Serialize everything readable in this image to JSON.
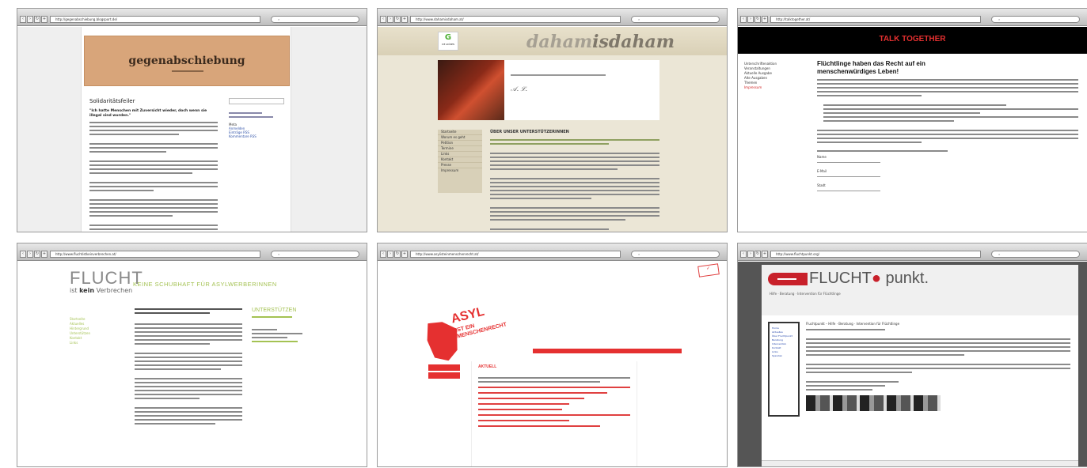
{
  "windows": [
    {
      "url": "http://gegenabschiebung.blogsport.de/",
      "page": {
        "blog_title": "gegenabschiebung",
        "section_title": "Solidaritätsfeiler",
        "quote": "\"Ich hatte Menschen mit Zuversicht wieder, doch wenn sie illegal sind wurden.\"",
        "sidebar_heading": "Meta",
        "sidebar_items": [
          "Anmelden",
          "Einträge RSS",
          "Kommentare RSS"
        ]
      }
    },
    {
      "url": "http://www.dahamisdaham.at/",
      "page": {
        "logo_letter": "G",
        "logo_sub": "DIE GRÜNEN",
        "site_title_prefix": "daham",
        "site_title_suffix": "isdaham",
        "heading": "ÜBER UNSER UNTERSTÜTZERINNEN",
        "menu": [
          "Startseite",
          "Worum es geht",
          "Petition",
          "Termine",
          "Links",
          "Kontakt",
          "Presse",
          "Impressum"
        ]
      }
    },
    {
      "url": "http://talktogether.at/",
      "page": {
        "banner": "TALK TOGETHER",
        "heading": "Flüchtlinge haben das Recht auf ein menschenwürdiges Leben!",
        "nav": [
          "Unterschriftenaktion",
          "Veranstaltungen",
          "Aktuelle Ausgabe",
          "Alte Ausgaben",
          "Themen",
          "Impressum"
        ],
        "fields": [
          "Name",
          "E-Mail",
          "Stadt"
        ]
      }
    },
    {
      "url": "http://www.fluchtistkeinverbrechen.at/",
      "page": {
        "logo_main": "FLUCHT",
        "logo_ist": "ist",
        "logo_kein": "kein",
        "logo_verbrechen": "Verbrechen",
        "tagline": "KEINE SCHUBHAFT FÜR ASYLWERBERINNEN",
        "side_heading": "UNTERSTÜTZEN",
        "nav": [
          "Startseite",
          "Aktuelles",
          "Hintergrund",
          "Unterstützen",
          "Kontakt",
          "Links"
        ]
      }
    },
    {
      "url": "http://www.asylisteinmenschenrecht.at/",
      "page": {
        "stamp_asyl": "ASYL",
        "stamp_rest": "IST EIN MENSCHENRECHT",
        "heading": "AKTUELL"
      }
    },
    {
      "url": "http://www.fluchtpunkt.org/",
      "page": {
        "logo_main": "FLUCHT",
        "logo_suffix": "punkt.",
        "tagline": "Hilfe · Beratung · Intervention für Flüchtlinge",
        "article_title": "Fluchtpunkt – Hilfe · Beratung · Intervention für Flüchtlinge",
        "nav": [
          "Home",
          "Aktuelles",
          "Über Fluchtpunkt",
          "Beratung",
          "Intervention",
          "Kontakt",
          "Links",
          "Spenden"
        ]
      }
    }
  ]
}
